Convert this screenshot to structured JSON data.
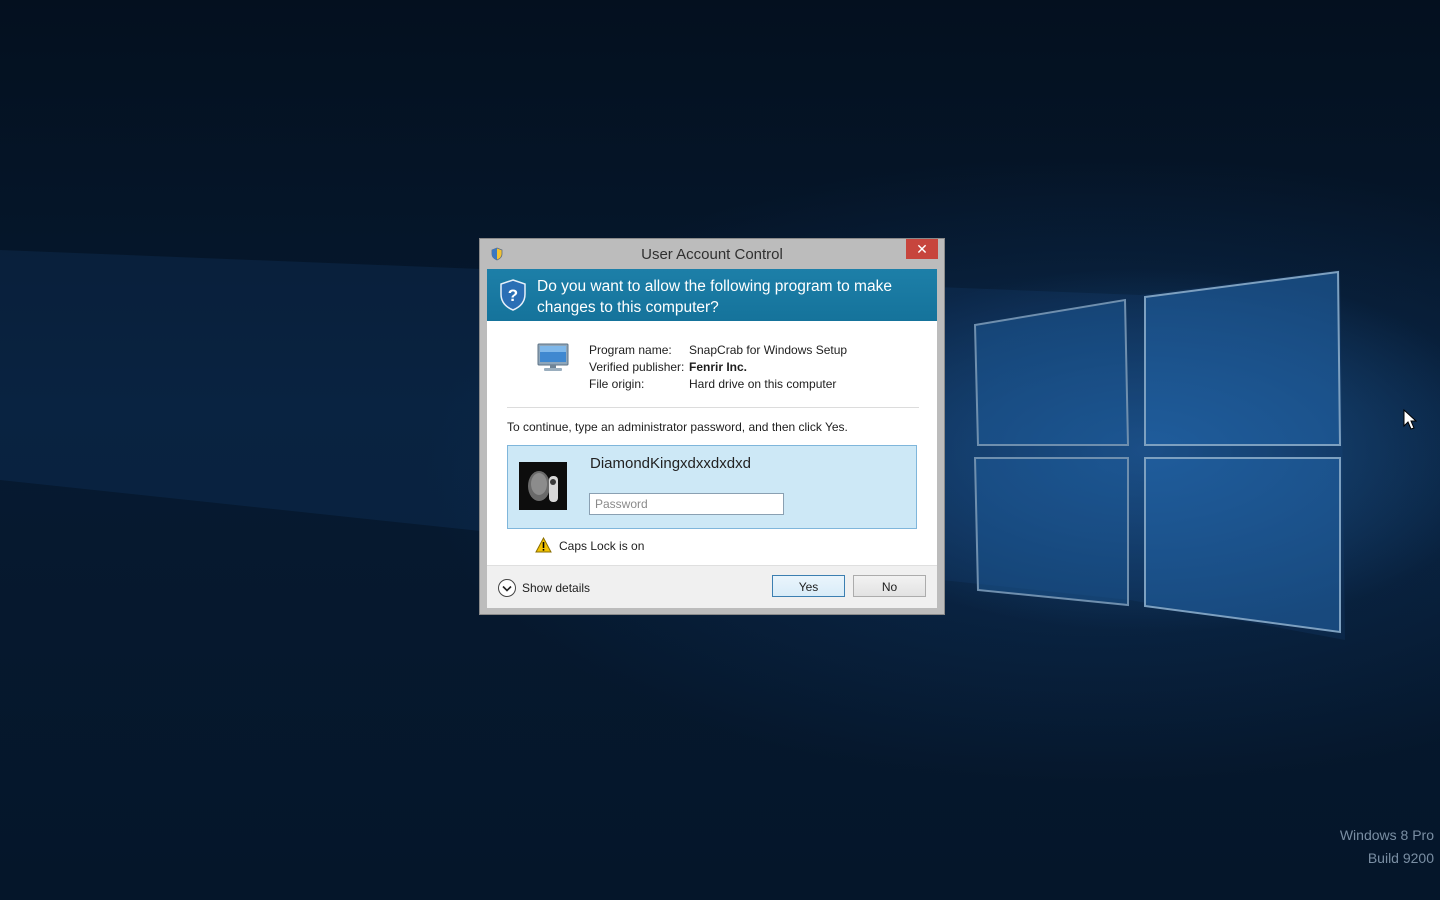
{
  "desktop": {
    "watermark_line1": "Windows 8 Pro",
    "watermark_line2": "Build 9200"
  },
  "dialog": {
    "title": "User Account Control",
    "close_glyph": "✕",
    "question": "Do you want to allow the following program to make changes to this computer?",
    "program_name_label": "Program name:",
    "program_name_value": "SnapCrab for Windows Setup",
    "publisher_label": "Verified publisher:",
    "publisher_value": "Fenrir Inc.",
    "origin_label": "File origin:",
    "origin_value": "Hard drive on this computer",
    "instruction": "To continue, type an administrator password, and then click Yes.",
    "username": "DiamondKingxdxxdxdxd",
    "password_placeholder": "Password",
    "password_value": "",
    "caps_warning": "Caps Lock is on",
    "show_details": "Show details",
    "yes_label": "Yes",
    "no_label": "No"
  },
  "icons": {
    "title": "uac-shield-icon",
    "banner": "question-shield-icon",
    "program": "monitor-icon",
    "warning": "warning-icon",
    "details": "chevron-down-circle-icon",
    "cursor": "mouse-pointer-icon"
  },
  "colors": {
    "banner": "#1d7fa8",
    "close_button": "#c7453d",
    "credential_tile": "#cde8f6",
    "desktop": "#05162a"
  }
}
